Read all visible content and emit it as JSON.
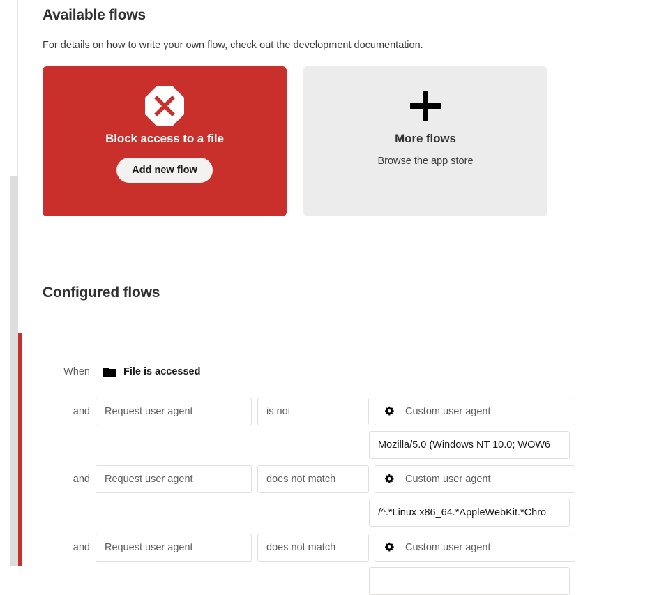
{
  "available": {
    "title": "Available flows",
    "description": "For details on how to write your own flow, check out the development documentation.",
    "cards": [
      {
        "icon": "block-octagon-icon",
        "title": "Block access to a file",
        "button_label": "Add new flow",
        "accent": "#c9302c",
        "style": "danger"
      },
      {
        "icon": "plus-icon",
        "title": "More flows",
        "subtitle": "Browse the app store",
        "accent": "#ececec",
        "style": "neutral"
      }
    ]
  },
  "configured": {
    "title": "Configured flows",
    "accent_bar_color": "#c9302c",
    "flow": {
      "when_label": "When",
      "trigger_icon": "folder-icon",
      "trigger_text": "File is accessed",
      "and_label": "and",
      "conditions": [
        {
          "property": "Request user agent",
          "operator": "is not",
          "target_icon": "gear-icon",
          "target": "Custom user agent",
          "value": "Mozilla/5.0 (Windows NT 10.0; WOW6"
        },
        {
          "property": "Request user agent",
          "operator": "does not match",
          "target_icon": "gear-icon",
          "target": "Custom user agent",
          "value": "/^.*Linux x86_64.*AppleWebKit.*Chro"
        },
        {
          "property": "Request user agent",
          "operator": "does not match",
          "target_icon": "gear-icon",
          "target": "Custom user agent",
          "value": ""
        }
      ]
    }
  },
  "scrollbar": {
    "orientation": "vertical",
    "thumb_color": "#dddddd",
    "track_color": "#e6e6e6"
  }
}
